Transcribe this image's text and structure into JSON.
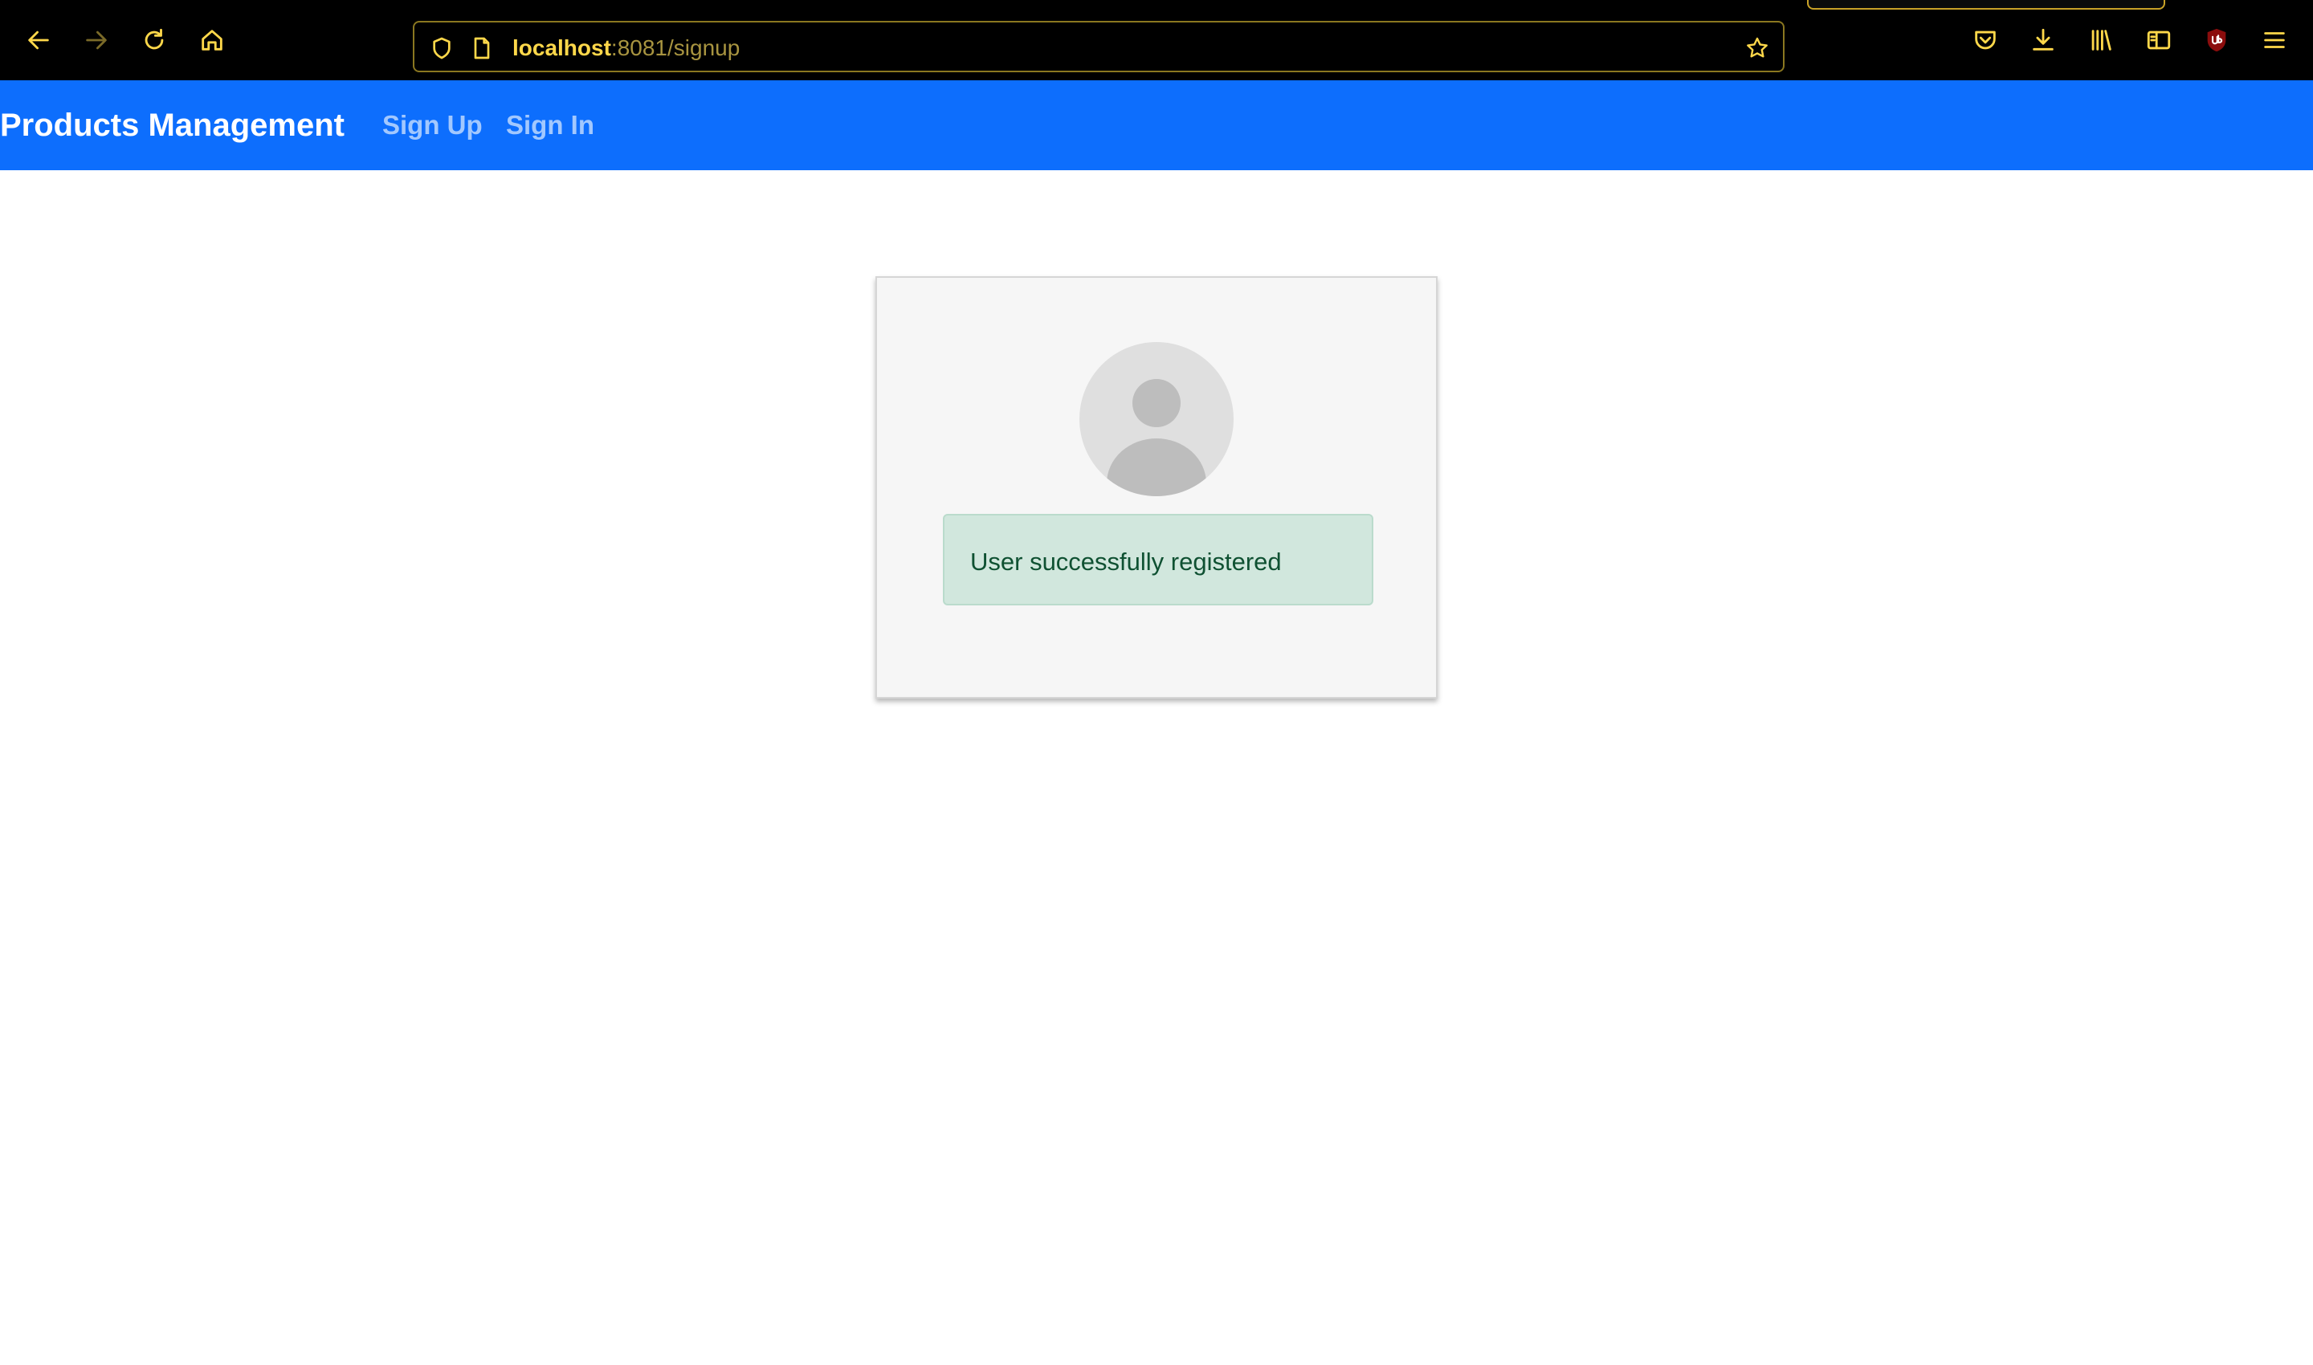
{
  "browser": {
    "url_host": "localhost",
    "url_rest": ":8081/signup",
    "toolbar_icons": [
      "back-arrow-icon",
      "forward-arrow-icon",
      "reload-icon",
      "home-icon",
      "pocket-icon",
      "download-icon",
      "library-icon",
      "sidebar-icon",
      "ublock-icon",
      "menu-icon"
    ],
    "accent_color": "#ffd84a"
  },
  "navbar": {
    "brand": "Products Management",
    "links": [
      {
        "label": "Sign Up"
      },
      {
        "label": "Sign In"
      }
    ],
    "background": "#0d6efd"
  },
  "card": {
    "avatar_icon": "user-avatar-icon",
    "alert_text": "User successfully registered",
    "alert_color": "#d1e7dd"
  }
}
